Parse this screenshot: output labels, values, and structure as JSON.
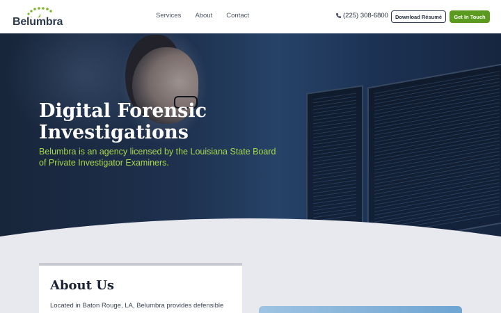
{
  "header": {
    "logo_text": "Belumbra",
    "nav": [
      "Services",
      "About",
      "Contact"
    ],
    "phone": "(225) 308-6800",
    "resume_button": "Download Résumé",
    "contact_button": "Get In Touch"
  },
  "hero": {
    "title": "Digital Forensic Investigations",
    "subtitle": "Belumbra is an agency licensed by the Louisiana State Board of Private Investigator Examiners."
  },
  "about": {
    "title": "About Us",
    "text": "Located in Baton Rouge, LA, Belumbra provides defensible"
  },
  "colors": {
    "brand_green": "#5a9a1e",
    "subtitle_green": "#a6d84a",
    "navy": "#2d3a4d",
    "page_bg": "#e8e9ee"
  },
  "icons": {
    "phone": "phone-icon",
    "logo": "logo-mark-icon"
  }
}
